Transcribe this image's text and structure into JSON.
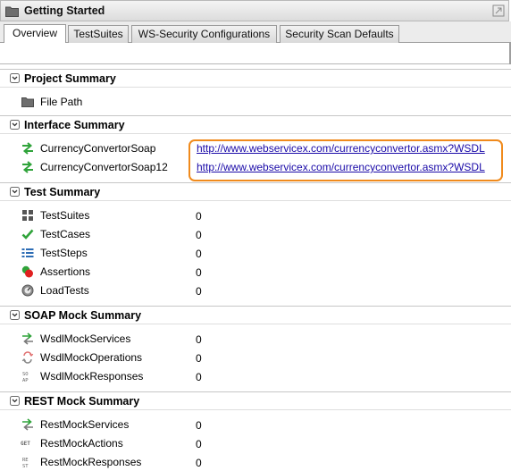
{
  "window": {
    "title": "Getting Started"
  },
  "tabs": [
    {
      "label": "Overview"
    },
    {
      "label": "TestSuites"
    },
    {
      "label": "WS-Security Configurations"
    },
    {
      "label": "Security Scan Defaults"
    }
  ],
  "project_summary": {
    "title": "Project Summary",
    "file_path_label": "File Path"
  },
  "interface_summary": {
    "title": "Interface Summary",
    "items": [
      {
        "name": "CurrencyConvertorSoap",
        "url": "http://www.webservicex.com/currencyconvertor.asmx?WSDL"
      },
      {
        "name": "CurrencyConvertorSoap12",
        "url": "http://www.webservicex.com/currencyconvertor.asmx?WSDL"
      }
    ]
  },
  "test_summary": {
    "title": "Test Summary",
    "items": [
      {
        "name": "TestSuites",
        "value": "0",
        "icon": "grid-icon"
      },
      {
        "name": "TestCases",
        "value": "0",
        "icon": "checkmark-icon"
      },
      {
        "name": "TestSteps",
        "value": "0",
        "icon": "list-icon"
      },
      {
        "name": "Assertions",
        "value": "0",
        "icon": "assertion-icon"
      },
      {
        "name": "LoadTests",
        "value": "0",
        "icon": "gauge-icon"
      }
    ]
  },
  "soap_mock_summary": {
    "title": "SOAP Mock Summary",
    "items": [
      {
        "name": "WsdlMockServices",
        "value": "0",
        "icon": "mock-service-icon"
      },
      {
        "name": "WsdlMockOperations",
        "value": "0",
        "icon": "mock-operation-icon"
      },
      {
        "name": "WsdlMockResponses",
        "value": "0",
        "icon": "mock-response-icon"
      }
    ]
  },
  "rest_mock_summary": {
    "title": "REST Mock Summary",
    "items": [
      {
        "name": "RestMockServices",
        "value": "0",
        "icon": "rest-service-icon"
      },
      {
        "name": "RestMockActions",
        "value": "0",
        "icon": "get-icon",
        "icon_text": "GET"
      },
      {
        "name": "RestMockResponses",
        "value": "0",
        "icon": "rest-response-icon",
        "icon_text": "RE ST"
      }
    ]
  },
  "colors": {
    "link": "#1a0aa8",
    "highlight": "#f08a1c",
    "green": "#2fa33a",
    "red": "#e02020",
    "blue": "#2d6db5"
  }
}
